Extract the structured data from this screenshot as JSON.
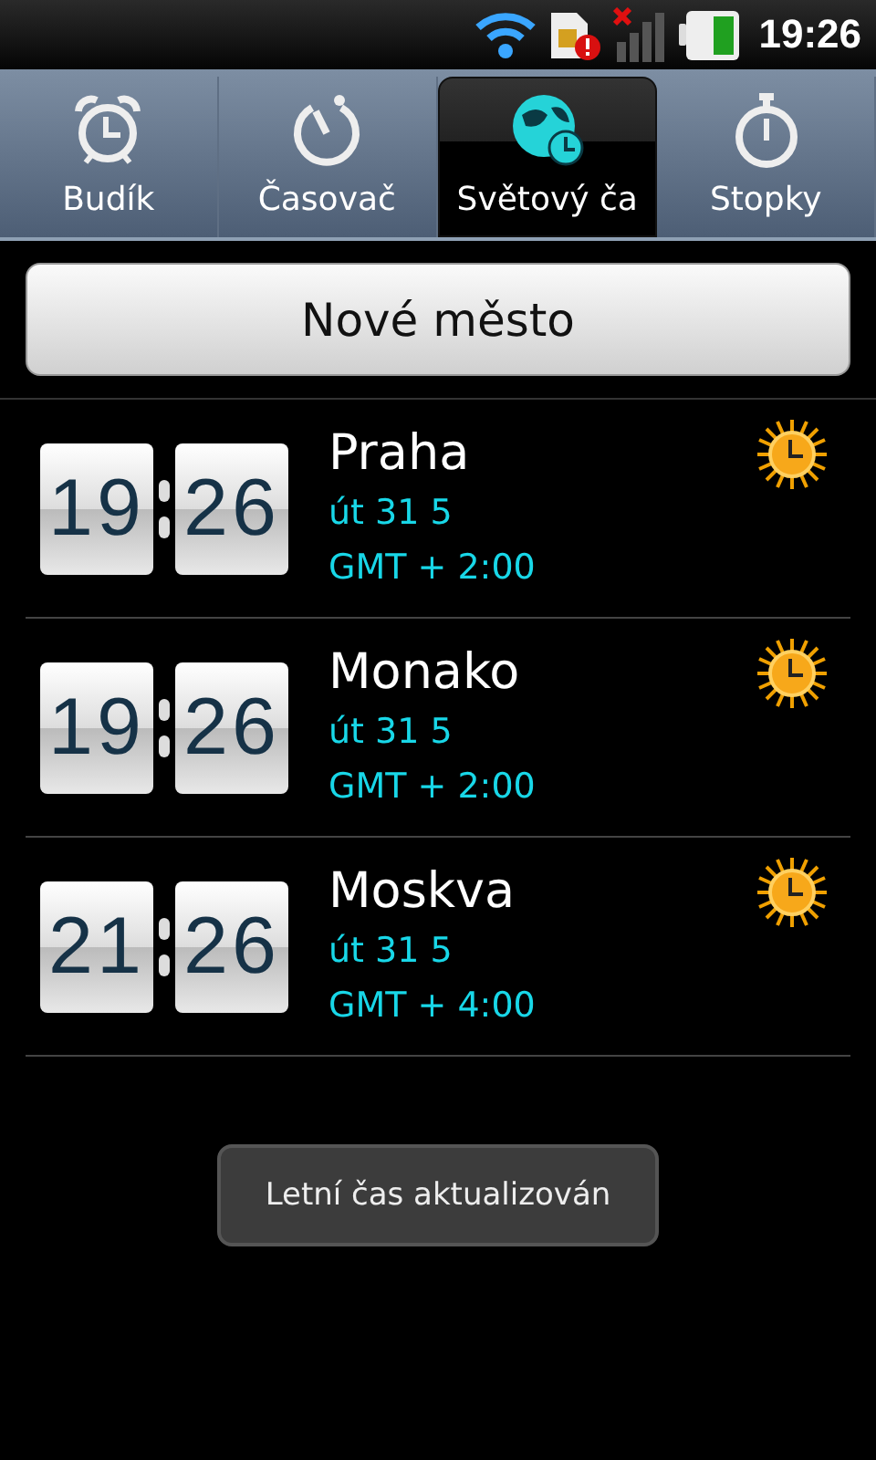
{
  "status_bar": {
    "time": "19:26"
  },
  "tabs": [
    {
      "label": "Budík",
      "kind": "alarm",
      "selected": false
    },
    {
      "label": "Časovač",
      "kind": "timer",
      "selected": false
    },
    {
      "label": "Světový ča",
      "kind": "globe",
      "selected": true
    },
    {
      "label": "Stopky",
      "kind": "stopwatch",
      "selected": false
    }
  ],
  "add_button": "Nové město",
  "cities": [
    {
      "hours": "19",
      "minutes": "26",
      "name": "Praha",
      "date": "út 31 5",
      "offset": "GMT + 2:00"
    },
    {
      "hours": "19",
      "minutes": "26",
      "name": "Monako",
      "date": "út 31 5",
      "offset": "GMT + 2:00"
    },
    {
      "hours": "21",
      "minutes": "26",
      "name": "Moskva",
      "date": "út 31 5",
      "offset": "GMT + 4:00"
    }
  ],
  "toast": "Letní čas aktualizován"
}
